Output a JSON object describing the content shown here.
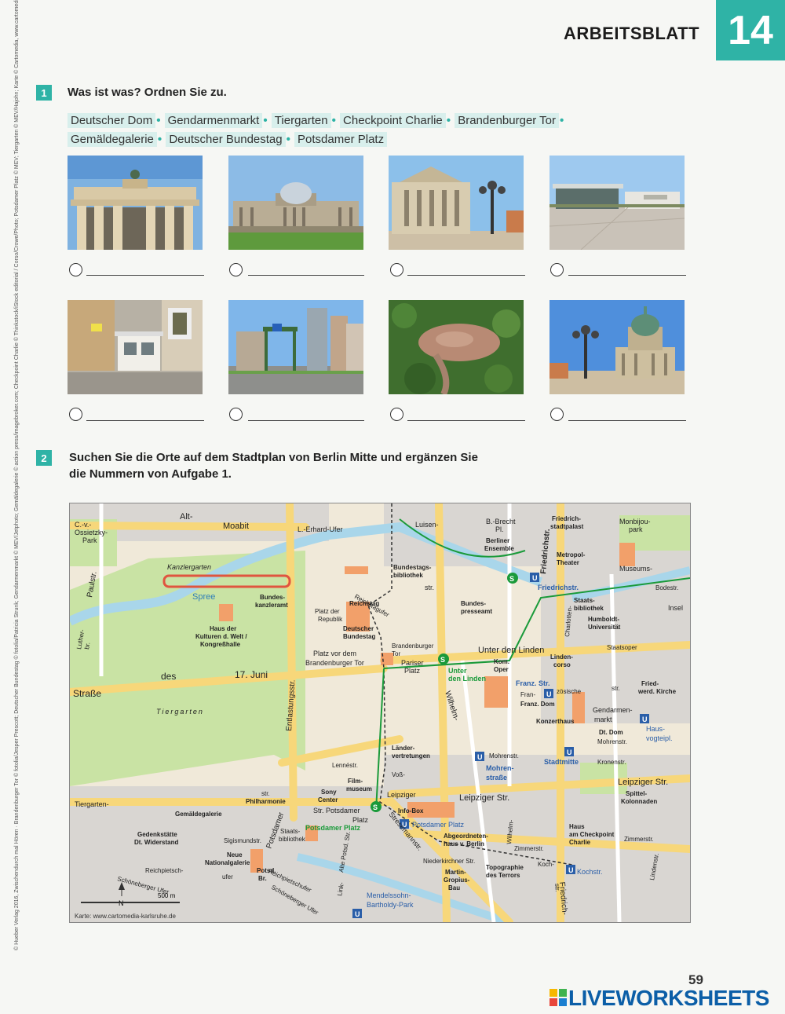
{
  "header": {
    "title": "ARBEITSBLATT",
    "chapter": "14"
  },
  "exercise1": {
    "number": "1",
    "instruction": "Was ist was? Ordnen Sie zu.",
    "words": [
      "Deutscher Dom",
      "Gendarmenmarkt",
      "Tiergarten",
      "Checkpoint Charlie",
      "Brandenburger Tor",
      "Gemäldegalerie",
      "Deutscher Bundestag",
      "Potsdamer Platz"
    ],
    "photos": [
      "brandenburger-tor-photo",
      "reichstag-photo",
      "konzerthaus-photo",
      "kulturforum-photo",
      "checkpoint-charlie-photo",
      "potsdamer-platz-photo",
      "tiergarten-aerial-photo",
      "deutscher-dom-photo"
    ]
  },
  "exercise2": {
    "number": "2",
    "instruction_line1": "Suchen Sie die Orte auf dem Stadtplan von Berlin Mitte und ergänzen Sie",
    "instruction_line2": "die Nummern von Aufgabe 1."
  },
  "map": {
    "credit": "Karte: www.cartomedia-karlsruhe.de",
    "scale_zero": "0",
    "scale_label": "500 m",
    "north": "N",
    "labels": {
      "alt_moabit_1": "Alt-",
      "alt_moabit_2": "Moabit",
      "cv_park_1": "C.-v.-",
      "cv_park_2": "Ossietzky-",
      "cv_park_3": "Park",
      "erhard_ufer": "L.-Erhard-Ufer",
      "luisen": "Luisen-",
      "luisen_str": "str.",
      "brecht_1": "B.-Brecht",
      "brecht_2": "Pl.",
      "friedrichstadt_1": "Friedrich-",
      "friedrichstadt_2": "stadtpalast",
      "friedrichstr_v": "Friedrichstr.",
      "monbijou_1": "Monbijou-",
      "monbijou_2": "park",
      "berliner_ens_1": "Berliner",
      "berliner_ens_2": "Ensemble",
      "metropol_1": "Metropol-",
      "metropol_2": "Theater",
      "museums": "Museums-",
      "insel": "Insel",
      "kanzlergarten": "Kanzlergarten",
      "paulstr": "Paulstr.",
      "bt_bib_1": "Bundestags-",
      "bt_bib_2": "bibliothek",
      "friedrichstr_station": "Friedrichstr.",
      "spree": "Spree",
      "bka_1": "Bundes-",
      "bka_2": "kanzleramt",
      "reichstag": "Reichstag",
      "platz_rep_1": "Platz der",
      "platz_rep_2": "Republik",
      "reichstagufer": "Reichstagufer",
      "bpresse_1": "Bundes-",
      "bpresse_2": "presseamt",
      "staatsbib_1": "Staats-",
      "staatsbib_2": "bibliothek",
      "charlotten": "Charlotten-",
      "humboldt_1": "Humboldt-",
      "humboldt_2": "Universität",
      "bodestr": "Bodestr.",
      "hkw_1": "Haus der",
      "hkw_2": "Kulturen d. Welt /",
      "hkw_3": "Kongreßhalle",
      "luther_1": "Luther-",
      "luther_2": "br.",
      "dbt_1": "Deutscher",
      "dbt_2": "Bundestag",
      "bt_tor_1": "Brandenburger",
      "bt_tor_2": "Tor",
      "staatsoper": "Staatsoper",
      "udl_street": "Unter den Linden",
      "lindencorso_1": "Linden-",
      "lindencorso_2": "corso",
      "pvbt_1": "Platz vor dem",
      "pvbt_2": "Brandenburger Tor",
      "pariser_1": "Pariser",
      "pariser_2": "Platz",
      "udl_s1": "Unter",
      "udl_s2": "den Linden",
      "komoper_1": "Kom.",
      "komoper_2": "Oper",
      "franz_str_1": "Franz. Str.",
      "franz_str_2": "Fran-",
      "franz_str_3": "zösische",
      "str_short": "str.",
      "werder_1": "Fried-",
      "werder_2": "werd. Kirche",
      "entlastung": "Entlastungsstr.",
      "juni": "17. Juni",
      "strasse": "Straße",
      "des": "des",
      "franz_dom": "Franz. Dom",
      "gendarmen_1": "Gendarmen-",
      "gendarmen_2": "markt",
      "konzerthaus": "Konzerthaus",
      "tiergarten": "Tiergarten",
      "wilhelm": "Wilhelm-",
      "dt_dom": "Dt. Dom",
      "mohrenstr": "Mohrenstr.",
      "hausvogtei_1": "Haus-",
      "hausvogtei_2": "vogteipl.",
      "laender_1": "Länder-",
      "laender_2": "vertretungen",
      "mohrenstr2": "Mohrenstr.",
      "mohrenstrasse_1": "Mohren-",
      "mohrenstrasse_2": "straße",
      "stadtmitte": "Stadtmitte",
      "kronenstr": "Kronenstr.",
      "lenne": "Lennéstr.",
      "filmmuseum_1": "Film-",
      "filmmuseum_2": "museum",
      "voss": "Voß-",
      "leipziger_1": "Leipziger",
      "leipziger_2": "Platz",
      "leipziger_str": "Leipziger Str.",
      "leipziger_str2": "Leipziger Str.",
      "tiergartenstr": "Tiergarten-",
      "philharmonie_str": "str.",
      "philharmonie": "Philharmonie",
      "sony_1": "Sony",
      "sony_2": "Center",
      "infobox_1": "Info-Box",
      "pdp_1": "Str. Potsdamer",
      "pdp_2": "Platz",
      "potsdamer_platz_s": "Potsdamer Platz",
      "potsdamer_platz_u": "Potsdamer Platz",
      "spittel_1": "Spittel-",
      "spittel_2": "Kolonnaden",
      "gemaelde": "Gemäldegalerie",
      "sigismund": "Sigismundstr.",
      "potsdamer_v": "Potsdamer",
      "staatsbib2_1": "Staats-",
      "staatsbib2_2": "bibliothek",
      "gedenk_1": "Gedenkstätte",
      "gedenk_2": "Dt. Widerstand",
      "nng_1": "Neue",
      "nng_2": "Nationalgalerie",
      "abg_1": "Abgeordneten-",
      "abg_2": "haus v. Berlin",
      "hcc_1": "Haus",
      "hcc_2": "am Checkpoint",
      "hcc_3": "Charlie",
      "zimmer_1": "Zimmerstr.",
      "zimmer_2": "Zimmerstr.",
      "stresemann": "Stresemannstr.",
      "niederkirchner": "Niederkirchner Str.",
      "koch": "Koch-",
      "reichpietsch": "Reichpietsch-",
      "ufer": "ufer",
      "potsd_br": "Potsd.",
      "br": "Br.",
      "reichpietschufer2": "Reichpietschufer",
      "schoeneberger_1": "Schöneberger Ufer",
      "schoeneberger_2": "Schöneberger Ufer",
      "link": "Link-",
      "alte_potsdamer": "Alte Potsd. Str.",
      "mgb_1": "Martin-",
      "mgb_2": "Gropius-",
      "mgb_3": "Bau",
      "topo_1": "Topographie",
      "topo_2": "des Terrors",
      "kochstr": "Kochstr.",
      "friedrich_v2": "Friedrich-",
      "str_v2": "str.",
      "lindenstr": "Lindenstr.",
      "wilhelm2": "Wilhelm-",
      "mendelssohn_1": "Mendelssohn-",
      "mendelssohn_2": "Bartholdy-Park"
    }
  },
  "footer": {
    "page_number": "59",
    "brand": "LIVEWORKSHEETS"
  },
  "side_credit": "© Hueber Verlag 2016, Zwischendurch mal Hören · Brandenburger Tor © fotolia/Jesper Prescott; Deutscher Bundestag © fotolia/Patricia Strunk; Gendarmenmarkt © MEV/Jetphoto; Gemäldegalerie © action press/imagebroker.com; Checkpoint Charlie © Thinkstock/iStock editorial / Corso/Crowe/Photo; Potsdamer Platz © MEV; Tiergarten © MEV/Hajohn; Karte © Cartomedia, www.cartomedia-karlsruhe.de",
  "colors": {
    "accent": "#2fb3a6",
    "brand": "#0b5ea7",
    "park": "#c9e3a4",
    "street": "#f7d77a",
    "block": "#f6c49c",
    "water": "#a9d6ea",
    "rail": "#1a9a3a"
  }
}
